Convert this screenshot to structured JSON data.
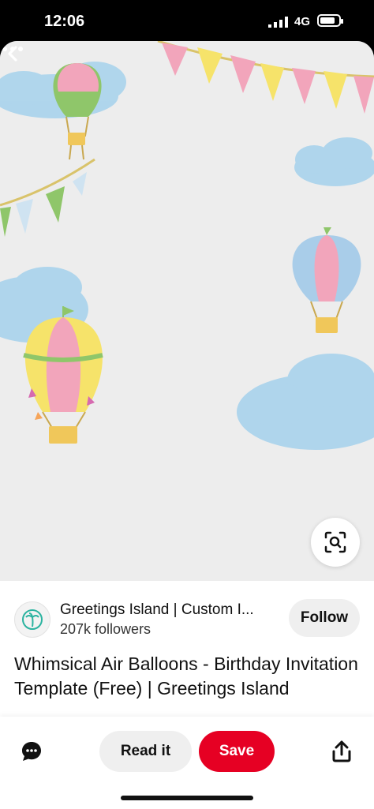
{
  "status_bar": {
    "time": "12:06",
    "network": "4G"
  },
  "pin": {
    "image_theme_icons": [
      "hot-air-balloon",
      "cloud",
      "bunting-flags"
    ],
    "colors": {
      "cloud": "#a9d3ec",
      "balloon_pink": "#f2a5bb",
      "balloon_yellow": "#f6e36a",
      "balloon_green": "#8fc66a",
      "balloon_blue": "#a9cde9"
    }
  },
  "creator": {
    "name": "Greetings Island | Custom I...",
    "followers": "207k followers",
    "follow_label": "Follow",
    "avatar_icon": "palm-tree-icon",
    "avatar_color": "#2bb3a0"
  },
  "title": "Whimsical Air Balloons - Birthday Invitation Template (Free) | Greetings Island",
  "actions": {
    "read_label": "Read it",
    "save_label": "Save",
    "save_color": "#e60023"
  }
}
